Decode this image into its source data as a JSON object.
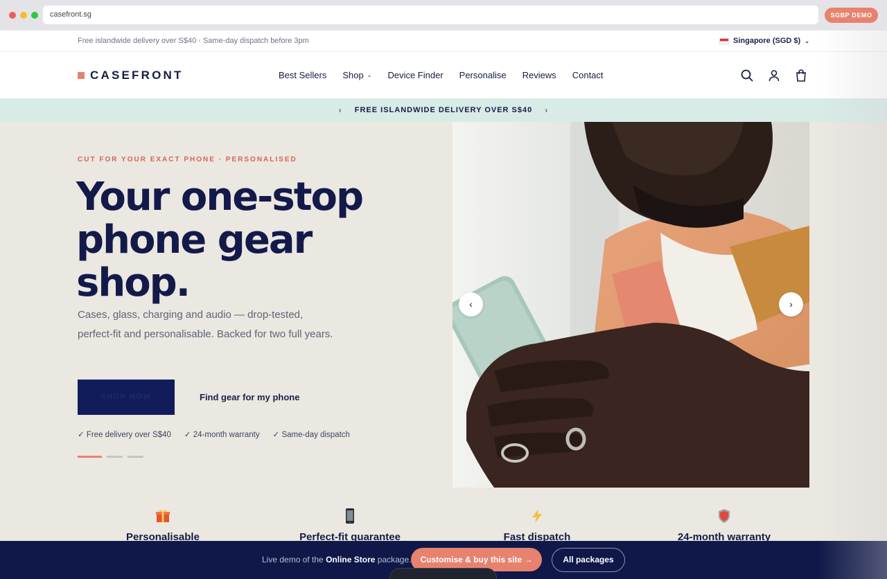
{
  "browser": {
    "url": "casefront.sg",
    "badge": "SGBP DEMO"
  },
  "utility": {
    "promo": "Free islandwide delivery over S$40 · Same-day dispatch before 3pm",
    "region": "Singapore (SGD $)"
  },
  "header": {
    "logo": "CASEFRONT",
    "nav": [
      "Best Sellers",
      "Shop",
      "Device Finder",
      "Personalise",
      "Reviews",
      "Contact"
    ],
    "icons": [
      "search-icon",
      "account-icon",
      "cart-icon"
    ]
  },
  "announcement": {
    "text": "FREE ISLANDWIDE DELIVERY OVER S$40",
    "prev": "‹",
    "next": "›"
  },
  "hero": {
    "eyebrow": "CUT FOR YOUR EXACT PHONE · PERSONALISED",
    "headline": "Your one-stop phone gear shop.",
    "subtext": "Cases, glass, charging and audio — drop-tested, perfect-fit and personalisable. Backed for two full years.",
    "cta_primary": "SHOP NOW",
    "cta_secondary": "Find gear for my phone",
    "trust": [
      "✓ Free delivery over S$40",
      "✓ 24-month warranty",
      "✓ Same-day dispatch"
    ],
    "slides": 3,
    "active_slide": 1,
    "arrow_prev": "‹",
    "arrow_next": "›"
  },
  "features": [
    {
      "icon": "gift-icon",
      "title": "Personalisable"
    },
    {
      "icon": "phone-icon",
      "title": "Perfect-fit guarantee"
    },
    {
      "icon": "lightning-icon",
      "title": "Fast dispatch"
    },
    {
      "icon": "shield-icon",
      "title": "24-month warranty"
    }
  ],
  "demo_bar": {
    "text_prefix": "Live demo of the",
    "text_bold": "Online Store",
    "text_suffix": "package.",
    "customise": "Customise & buy this site →",
    "packages": "All packages"
  },
  "colors": {
    "accent": "#e7826e",
    "navy": "#131a4a",
    "announce_bg": "#d8ebe7",
    "hero_bg": "#ebe7e1"
  }
}
